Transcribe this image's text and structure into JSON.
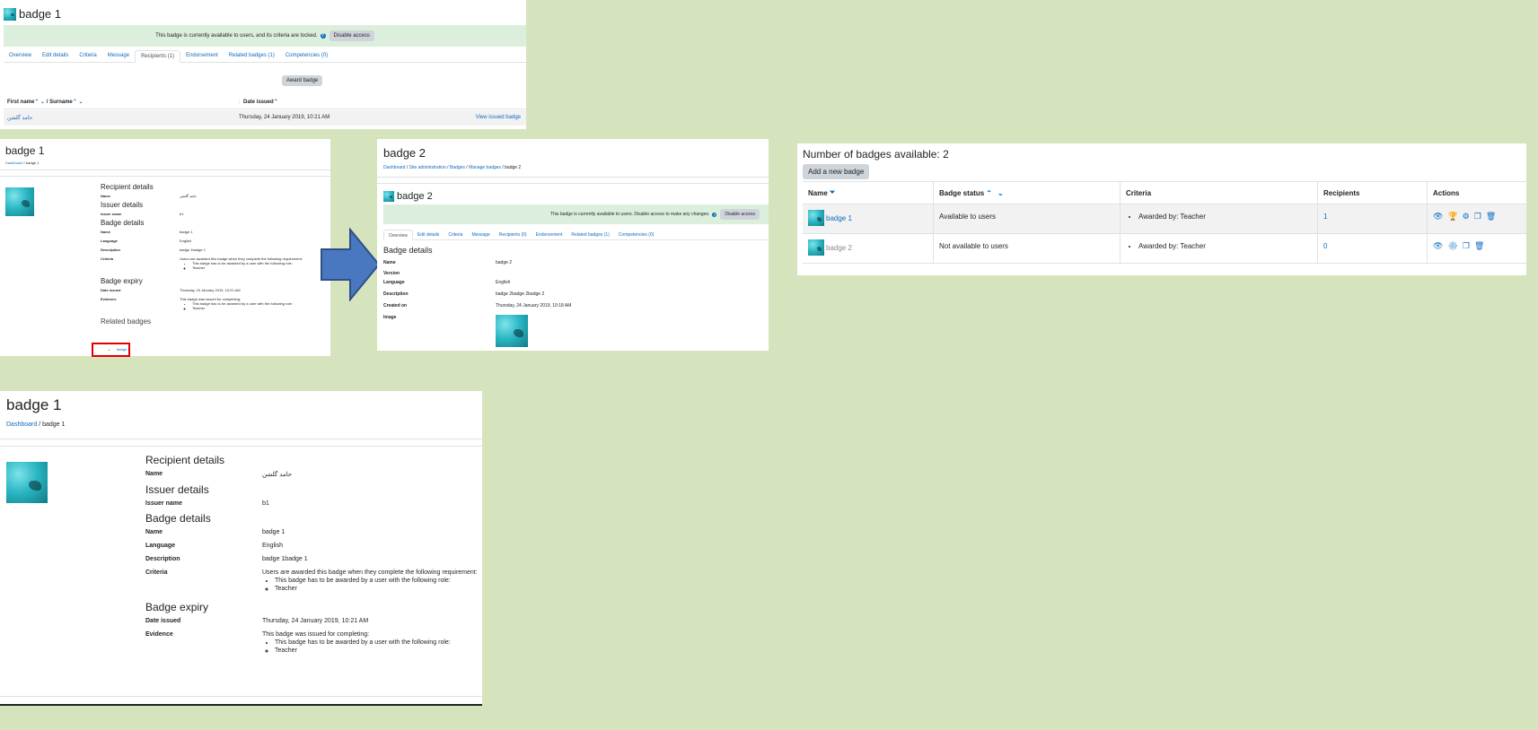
{
  "p1": {
    "title": "badge 1",
    "notice": "This badge is currently available to users, and its criteria are locked.",
    "disable_btn": "Disable access",
    "tabs": [
      "Overview",
      "Edit details",
      "Criteria",
      "Message",
      "Recipients (1)",
      "Endorsement",
      "Related badges (1)",
      "Competencies (0)"
    ],
    "active_tab": 4,
    "award_btn": "Award badge",
    "col_first": "First name",
    "col_sep": " / Surname",
    "col_date": "Date issued",
    "row": {
      "name": "حامد گلشن",
      "date": "Thursday, 24 January 2019, 10:21 AM",
      "action": "View issued badge"
    }
  },
  "p2": {
    "title": "badge 1",
    "crumb_dashboard": "Dashboard",
    "crumb_current": "badge 1",
    "recipient_h": "Recipient details",
    "name_l": "Name",
    "name_v": "حامد گلشن",
    "issuer_h": "Issuer details",
    "issuer_l": "Issuer name",
    "issuer_v": "b1",
    "badge_h": "Badge details",
    "bname_l": "Name",
    "bname_v": "badge 1",
    "lang_l": "Language",
    "lang_v": "English",
    "desc_l": "Description",
    "desc_v": "badge 1badge 1",
    "crit_l": "Criteria",
    "crit_v": "Users are awarded this badge when they complete the following requirement:",
    "crit_item": "This badge has to be awarded by a user with the following role:",
    "crit_role": "Teacher",
    "expiry_h": "Badge expiry",
    "date_l": "Date issued",
    "date_v": "Thursday, 24 January 2019, 10:21 AM",
    "evid_l": "Evidence",
    "evid_v": "This badge was issued for completing:",
    "evid_item": "This badge has to be awarded by a user with the following role:",
    "evid_role": "Teacher",
    "related_h": "Related badges",
    "related_item": "badge 2",
    "highlight_color": "#e00000"
  },
  "p3": {
    "title": "badge 2",
    "crumbs": [
      "Dashboard",
      "Site administration",
      "Badges",
      "Manage badges",
      "badge 2"
    ],
    "subtitle": "badge 2",
    "notice": "This badge is currently available to users. Disable access to make any changes.",
    "disable_btn": "Disable access",
    "tabs": [
      "Overview",
      "Edit details",
      "Criteria",
      "Message",
      "Recipients (0)",
      "Endorsement",
      "Related badges (1)",
      "Competencies (0)"
    ],
    "active_tab": 0,
    "section_h": "Badge details",
    "rows": [
      {
        "l": "Name",
        "v": "badge 2"
      },
      {
        "l": "Version",
        "v": ""
      },
      {
        "l": "Language",
        "v": "English"
      },
      {
        "l": "Description",
        "v": "badge 2badge 2badge 2"
      },
      {
        "l": "Created on",
        "v": "Thursday, 24 January 2019, 10:18 AM"
      },
      {
        "l": "Image",
        "v": ""
      }
    ]
  },
  "p4": {
    "heading": "Number of badges available: 2",
    "add_btn": "Add a new badge",
    "cols": [
      "Name",
      "Badge status",
      "Criteria",
      "Recipients",
      "Actions"
    ],
    "rows": [
      {
        "name": "badge 1",
        "status": "Available to users",
        "criteria": "Awarded by: Teacher",
        "recipients": "1",
        "enabled": true
      },
      {
        "name": "badge 2",
        "status": "Not available to users",
        "criteria": "Awarded by: Teacher",
        "recipients": "0",
        "enabled": false
      }
    ]
  },
  "p5": {
    "title": "badge 1",
    "crumb_dashboard": "Dashboard",
    "crumb_current": "badge 1",
    "recipient_h": "Recipient details",
    "name_l": "Name",
    "name_v": "حامد گلشن",
    "issuer_h": "Issuer details",
    "issuer_l": "Issuer name",
    "issuer_v": "b1",
    "badge_h": "Badge details",
    "bname_l": "Name",
    "bname_v": "badge 1",
    "lang_l": "Language",
    "lang_v": "English",
    "desc_l": "Description",
    "desc_v": "badge 1badge 1",
    "crit_l": "Criteria",
    "crit_v": "Users are awarded this badge when they complete the following requirement:",
    "crit_item": "This badge has to be awarded by a user with the following role:",
    "crit_role": "Teacher",
    "expiry_h": "Badge expiry",
    "date_l": "Date issued",
    "date_v": "Thursday, 24 January 2019, 10:21 AM",
    "evid_l": "Evidence",
    "evid_v": "This badge was issued for completing:",
    "evid_item": "This badge has to be awarded by a user with the following role:",
    "evid_role": "Teacher"
  },
  "colors": {
    "arrow": "#4a78c0",
    "arrow_stroke": "#2f4f86",
    "link": "#0f6cbf",
    "notice_bg": "#dcefdc"
  }
}
